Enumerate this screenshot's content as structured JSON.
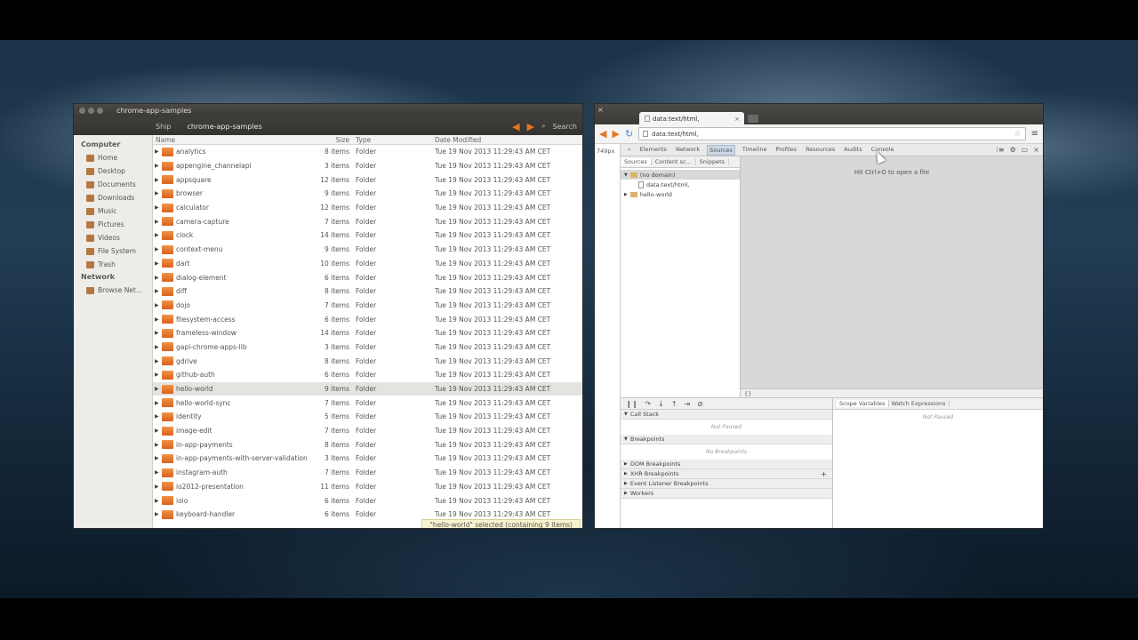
{
  "file_manager": {
    "title": "chrome-app-samples",
    "breadcrumbs": [
      "Ship",
      "chrome-app-samples"
    ],
    "search_label": "Search",
    "sidebar": {
      "sections": [
        {
          "heading": "Computer",
          "items": [
            "Home",
            "Desktop",
            "Documents",
            "Downloads",
            "Music",
            "Pictures",
            "Videos",
            "File System",
            "Trash"
          ]
        },
        {
          "heading": "Network",
          "items": [
            "Browse Net..."
          ]
        }
      ]
    },
    "columns": {
      "name": "Name",
      "size": "Size",
      "type": "Type",
      "date": "Date Modified"
    },
    "rows": [
      {
        "name": "analytics",
        "size": "8 items",
        "type": "Folder",
        "date": "Tue 19 Nov 2013 11:29:43 AM CET"
      },
      {
        "name": "appengine_channelapi",
        "size": "3 items",
        "type": "Folder",
        "date": "Tue 19 Nov 2013 11:29:43 AM CET"
      },
      {
        "name": "appsquare",
        "size": "12 items",
        "type": "Folder",
        "date": "Tue 19 Nov 2013 11:29:43 AM CET"
      },
      {
        "name": "browser",
        "size": "9 items",
        "type": "Folder",
        "date": "Tue 19 Nov 2013 11:29:43 AM CET"
      },
      {
        "name": "calculator",
        "size": "12 items",
        "type": "Folder",
        "date": "Tue 19 Nov 2013 11:29:43 AM CET"
      },
      {
        "name": "camera-capture",
        "size": "7 items",
        "type": "Folder",
        "date": "Tue 19 Nov 2013 11:29:43 AM CET"
      },
      {
        "name": "clock",
        "size": "14 items",
        "type": "Folder",
        "date": "Tue 19 Nov 2013 11:29:43 AM CET"
      },
      {
        "name": "context-menu",
        "size": "9 items",
        "type": "Folder",
        "date": "Tue 19 Nov 2013 11:29:43 AM CET"
      },
      {
        "name": "dart",
        "size": "10 items",
        "type": "Folder",
        "date": "Tue 19 Nov 2013 11:29:43 AM CET"
      },
      {
        "name": "dialog-element",
        "size": "6 items",
        "type": "Folder",
        "date": "Tue 19 Nov 2013 11:29:43 AM CET"
      },
      {
        "name": "diff",
        "size": "8 items",
        "type": "Folder",
        "date": "Tue 19 Nov 2013 11:29:43 AM CET"
      },
      {
        "name": "dojo",
        "size": "7 items",
        "type": "Folder",
        "date": "Tue 19 Nov 2013 11:29:43 AM CET"
      },
      {
        "name": "filesystem-access",
        "size": "6 items",
        "type": "Folder",
        "date": "Tue 19 Nov 2013 11:29:43 AM CET"
      },
      {
        "name": "frameless-window",
        "size": "14 items",
        "type": "Folder",
        "date": "Tue 19 Nov 2013 11:29:43 AM CET"
      },
      {
        "name": "gapi-chrome-apps-lib",
        "size": "3 items",
        "type": "Folder",
        "date": "Tue 19 Nov 2013 11:29:43 AM CET"
      },
      {
        "name": "gdrive",
        "size": "8 items",
        "type": "Folder",
        "date": "Tue 19 Nov 2013 11:29:43 AM CET"
      },
      {
        "name": "github-auth",
        "size": "6 items",
        "type": "Folder",
        "date": "Tue 19 Nov 2013 11:29:43 AM CET"
      },
      {
        "name": "hello-world",
        "size": "9 items",
        "type": "Folder",
        "date": "Tue 19 Nov 2013 11:29:43 AM CET",
        "selected": true
      },
      {
        "name": "hello-world-sync",
        "size": "7 items",
        "type": "Folder",
        "date": "Tue 19 Nov 2013 11:29:43 AM CET"
      },
      {
        "name": "identity",
        "size": "5 items",
        "type": "Folder",
        "date": "Tue 19 Nov 2013 11:29:43 AM CET"
      },
      {
        "name": "image-edit",
        "size": "7 items",
        "type": "Folder",
        "date": "Tue 19 Nov 2013 11:29:43 AM CET"
      },
      {
        "name": "in-app-payments",
        "size": "8 items",
        "type": "Folder",
        "date": "Tue 19 Nov 2013 11:29:43 AM CET"
      },
      {
        "name": "in-app-payments-with-server-validation",
        "size": "3 items",
        "type": "Folder",
        "date": "Tue 19 Nov 2013 11:29:43 AM CET"
      },
      {
        "name": "instagram-auth",
        "size": "7 items",
        "type": "Folder",
        "date": "Tue 19 Nov 2013 11:29:43 AM CET"
      },
      {
        "name": "io2012-presentation",
        "size": "11 items",
        "type": "Folder",
        "date": "Tue 19 Nov 2013 11:29:43 AM CET"
      },
      {
        "name": "ioio",
        "size": "6 items",
        "type": "Folder",
        "date": "Tue 19 Nov 2013 11:29:43 AM CET"
      },
      {
        "name": "keyboard-handler",
        "size": "6 items",
        "type": "Folder",
        "date": "Tue 19 Nov 2013 11:29:43 AM CET"
      }
    ],
    "status": "\"hello-world\" selected (containing 9 items)"
  },
  "chrome": {
    "tab_title": "data:text/html,",
    "url": "data:text/html,",
    "page_size_label": "749px",
    "devtools": {
      "tabs": [
        "Elements",
        "Network",
        "Sources",
        "Timeline",
        "Profiles",
        "Resources",
        "Audits",
        "Console"
      ],
      "active_tab": "Sources",
      "subtabs": [
        "Sources",
        "Content sc...",
        "Snippets"
      ],
      "tree": [
        {
          "label": "(no domain)",
          "kind": "folder",
          "expanded": true
        },
        {
          "label": "data:text/html,",
          "kind": "file"
        },
        {
          "label": "hello-world",
          "kind": "folder",
          "expanded": false
        }
      ],
      "editor_hint": "Hit Ctrl+O to open a file",
      "editor_footer": "{}",
      "debug_sections": [
        {
          "label": "Call Stack",
          "expanded": true,
          "empty": "Not Paused"
        },
        {
          "label": "Breakpoints",
          "expanded": true,
          "empty": "No Breakpoints"
        },
        {
          "label": "DOM Breakpoints",
          "expanded": false
        },
        {
          "label": "XHR Breakpoints",
          "expanded": false,
          "plus": "+"
        },
        {
          "label": "Event Listener Breakpoints",
          "expanded": false
        },
        {
          "label": "Workers",
          "expanded": false
        }
      ],
      "scope_tabs": [
        "Scope Variables",
        "Watch Expressions"
      ],
      "scope_empty": "Not Paused"
    }
  }
}
